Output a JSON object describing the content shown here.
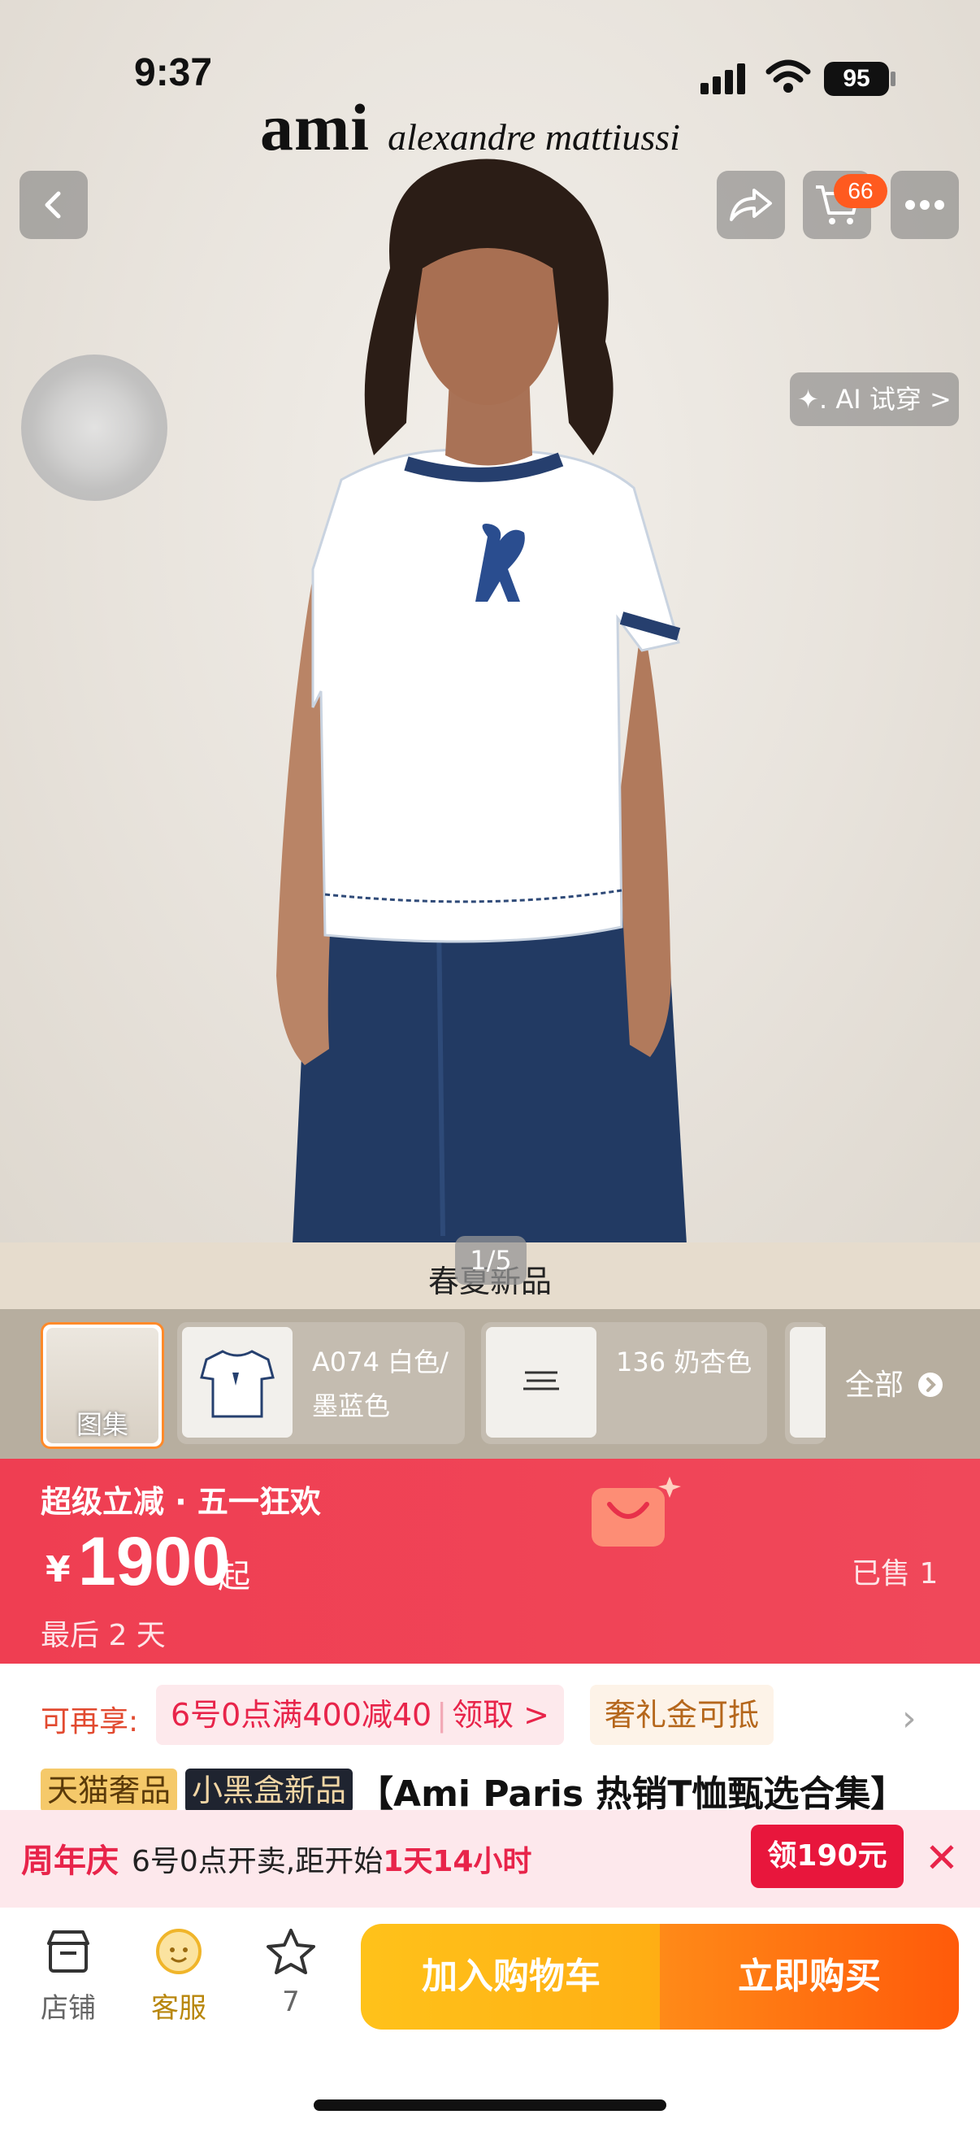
{
  "status_bar": {
    "time": "9:37",
    "battery": "95"
  },
  "brand": {
    "logo": "ami",
    "name": "alexandre mattiussi"
  },
  "header": {
    "cart_count": "66",
    "ai_try_on": "✦. AI 试穿 >"
  },
  "gallery": {
    "section_label": "春夏新品",
    "page_indicator": "1/5"
  },
  "variants": {
    "items": [
      {
        "label": "图集"
      },
      {
        "label": "A074 白色/墨蓝色"
      },
      {
        "label": "136 奶杏色"
      }
    ],
    "all_label": "全部"
  },
  "promo": {
    "title": "超级立减 · 五一狂欢",
    "currency": "¥",
    "price": "1900",
    "price_suffix": "起",
    "countdown": "最后 2 天",
    "sold": "已售 1"
  },
  "benefits": {
    "label": "可再享:",
    "coupon_text": "6号0点满400减40",
    "coupon_action": "领取 >",
    "gift_card": "奢礼金可抵"
  },
  "product": {
    "tag_tmall": "天猫奢品",
    "tag_blackbox": "小黑盒新品",
    "title": "【Ami Paris 热销T恤甄选合集】"
  },
  "anniversary": {
    "title": "周年庆",
    "text_prefix": "6号0点开卖,距开始",
    "text_highlight": "1天14小时",
    "button": "领190元"
  },
  "bottom_bar": {
    "store": "店铺",
    "service": "客服",
    "favorites_count": "7",
    "add_to_cart": "加入购物车",
    "buy_now": "立即购买"
  },
  "colors": {
    "promo_red": "#ef3e52",
    "accent_red": "#e8163c",
    "cart_yellow": "#ffc21a",
    "buy_orange": "#ff5a0a"
  }
}
